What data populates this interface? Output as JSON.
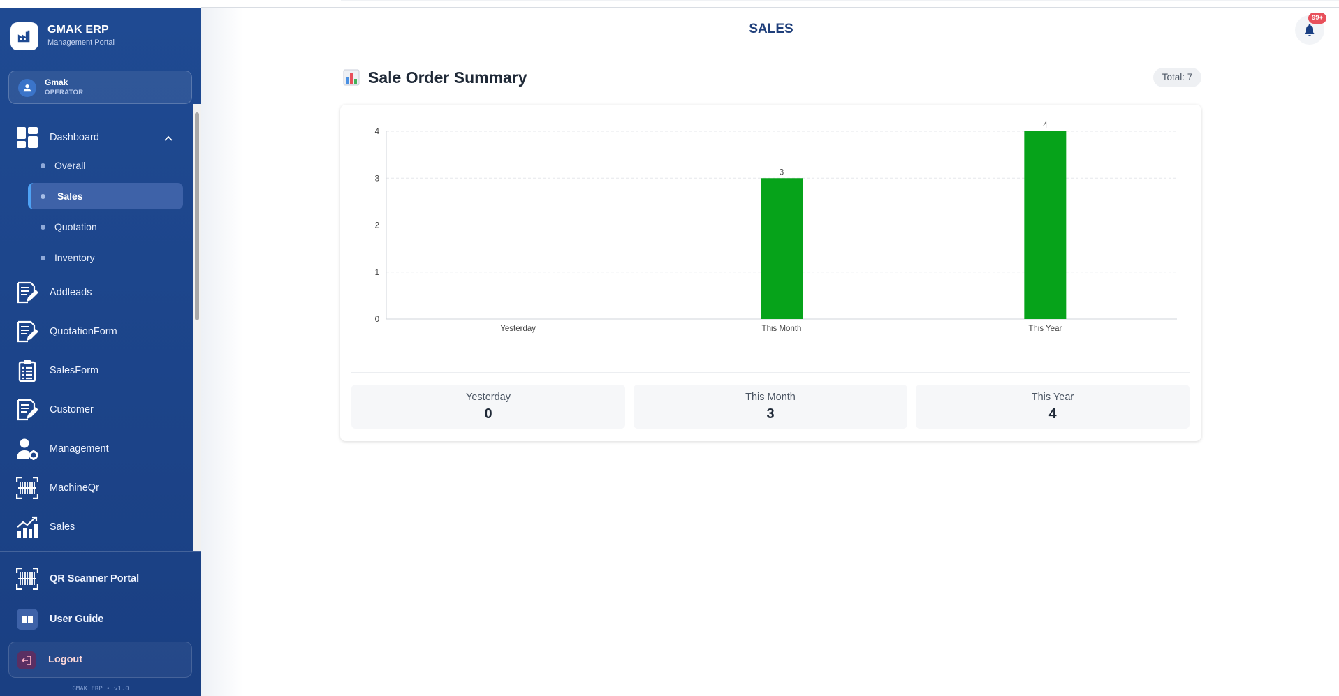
{
  "app": {
    "title": "GMAK ERP",
    "subtitle": "Management Portal",
    "version": "GMAK ERP • v1.0"
  },
  "user": {
    "name": "Gmak",
    "role": "OPERATOR"
  },
  "sidebar": {
    "dashboard": {
      "label": "Dashboard",
      "expanded": true
    },
    "sub_items": [
      {
        "label": "Overall",
        "active": false
      },
      {
        "label": "Sales",
        "active": true
      },
      {
        "label": "Quotation",
        "active": false
      },
      {
        "label": "Inventory",
        "active": false
      }
    ],
    "items": [
      {
        "label": "Addleads",
        "icon": "edit-document-icon"
      },
      {
        "label": "QuotationForm",
        "icon": "edit-document-icon"
      },
      {
        "label": "SalesForm",
        "icon": "clipboard-icon"
      },
      {
        "label": "Customer",
        "icon": "edit-document-icon"
      },
      {
        "label": "Management",
        "icon": "user-gear-icon"
      },
      {
        "label": "MachineQr",
        "icon": "barcode-scan-icon"
      },
      {
        "label": "Sales",
        "icon": "growth-chart-icon"
      }
    ],
    "bottom": {
      "qr_portal": "QR Scanner Portal",
      "user_guide": "User Guide",
      "logout": "Logout"
    }
  },
  "header": {
    "title": "SALES",
    "notification_badge": "99+"
  },
  "summary": {
    "icon": "bar-chart-icon",
    "title": "Sale Order Summary",
    "total": "Total: 7",
    "stats": [
      {
        "label": "Yesterday",
        "value": "0"
      },
      {
        "label": "This Month",
        "value": "3"
      },
      {
        "label": "This Year",
        "value": "4"
      }
    ]
  },
  "chart_data": {
    "type": "bar",
    "categories": [
      "Yesterday",
      "This Month",
      "This Year"
    ],
    "values": [
      0,
      3,
      4
    ],
    "ylim": [
      0,
      4
    ],
    "yticks": [
      0,
      1,
      2,
      3,
      4
    ],
    "grid": true,
    "bar_color": "#06a31a",
    "data_labels": true
  },
  "colors": {
    "sidebar_bg": "#1f4a92",
    "accent": "#4ea2f5",
    "title": "#1e3e7a",
    "badge": "#e8505b"
  }
}
